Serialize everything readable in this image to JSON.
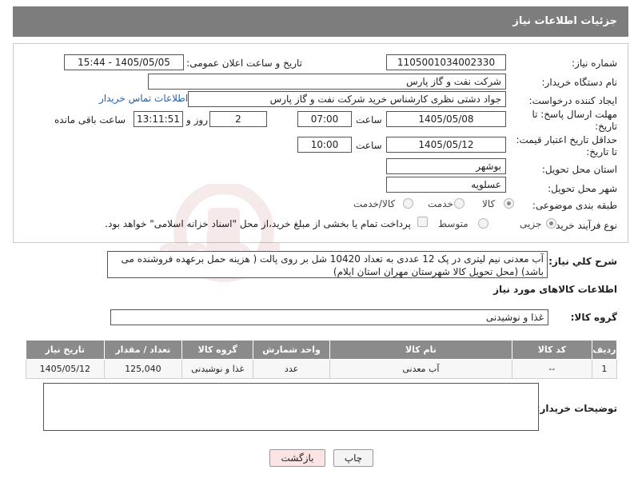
{
  "header": {
    "title": "جزئیات اطلاعات نیاز"
  },
  "form": {
    "need_number_label": "شماره نیاز:",
    "need_number": "1105001034002330",
    "announce_label": "تاریخ و ساعت اعلان عمومی:",
    "announce_value": "1405/05/05 - 15:44",
    "buyer_org_label": "نام دستگاه خریدار:",
    "buyer_org": "شرکت نفت و گاز پارس",
    "creator_label": "ایجاد کننده درخواست:",
    "creator": "جواد دشتی نظری کارشناس خرید  شرکت نفت و گاز پارس",
    "contact_link": "اطلاعات تماس خریدار",
    "reply_deadline_label_1": "مهلت ارسال پاسخ: تا",
    "reply_deadline_label_2": "تاریخ:",
    "reply_date": "1405/05/08",
    "time_label": "ساعت",
    "reply_time": "07:00",
    "days_count": "2",
    "days_label": "روز و",
    "remaining_time": "13:11:51",
    "remaining_label": "ساعت باقی مانده",
    "price_validity_label_1": "حداقل تاریخ اعتبار قیمت:",
    "price_validity_label_2": "تا تاریخ:",
    "price_date": "1405/05/12",
    "price_time": "10:00",
    "province_label": "استان محل تحویل:",
    "province": "بوشهر",
    "city_label": "شهر محل تحویل:",
    "city": "عسلویه",
    "category_label": "طبقه بندی موضوعی:",
    "category_options": [
      "کالا",
      "خدمت",
      "کالا/خدمت"
    ],
    "process_label": "نوع فرآیند خرید :",
    "process_options": [
      "جزیی",
      "متوسط"
    ],
    "payment_note": "پرداخت تمام یا بخشی از مبلغ خرید،از محل \"اسناد خزانه اسلامی\" خواهد بود."
  },
  "description": {
    "label": "شرح كلي نياز:",
    "text": "آب معدنی نیم لیتری در پک 12 عددی به تعداد 10420 شل بر روی پالت ( هزینه حمل برعهده فروشنده می باشد) (محل تحویل کالا شهرستان مهران استان ایلام)"
  },
  "goods_info_title": "اطلاعات کالاهای مورد نیاز",
  "goods_group_label": "گروه کالا:",
  "goods_group": "غذا و نوشیدنی",
  "table": {
    "headers": [
      "ردیف",
      "کد کالا",
      "نام کالا",
      "واحد شمارش",
      "گروه کالا",
      "تعداد / مقدار",
      "تاریخ نیاز"
    ],
    "rows": [
      [
        "1",
        "--",
        "آب معدنی",
        "عدد",
        "غذا و نوشیدنی",
        "125,040",
        "1405/05/12"
      ]
    ]
  },
  "notes_label": "توضیحات خریدار:",
  "buttons": {
    "print": "چاپ",
    "back": "بازگشت"
  },
  "colors": {
    "header_bg": "#7d7d7d",
    "table_header_bg": "#8b8b8b",
    "link": "#2a5fa5",
    "back_button_bg": "#fde4e4"
  }
}
